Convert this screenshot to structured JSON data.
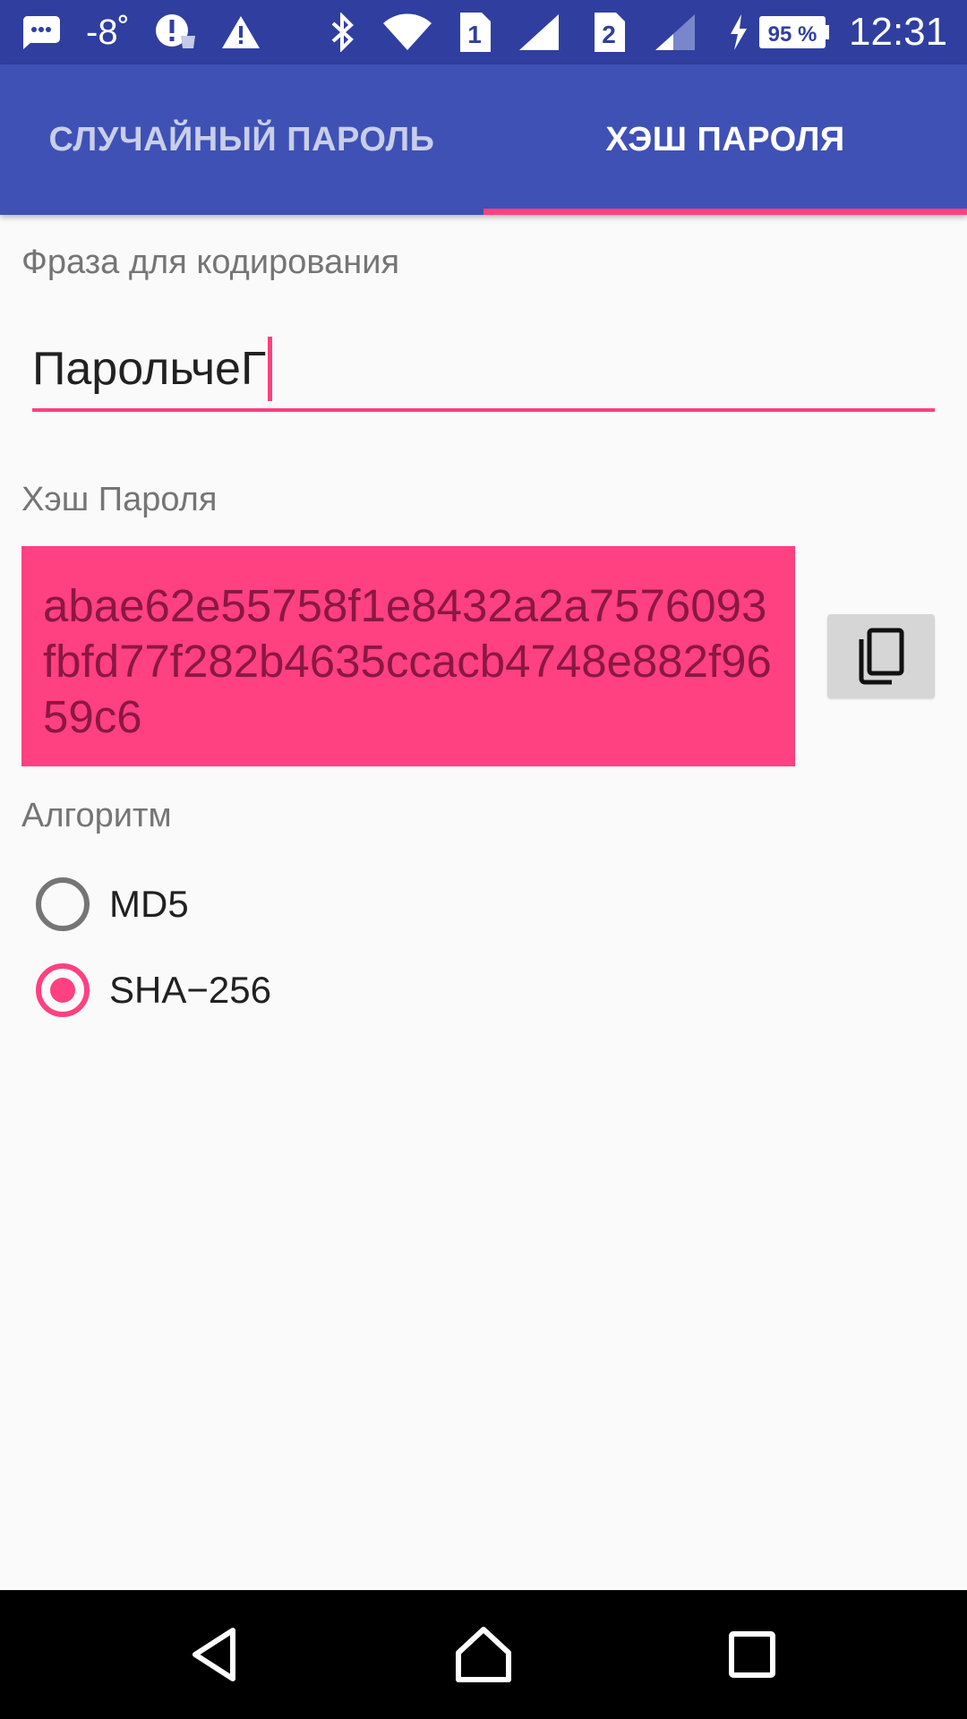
{
  "status_bar": {
    "temperature": "-8˚",
    "sim1": "1",
    "sim2": "2",
    "battery": "95 %",
    "time": "12:31",
    "icons": [
      "messages-icon",
      "alert-circle-icon",
      "warning-icon",
      "bluetooth-icon",
      "wifi-icon",
      "signal-icon",
      "charging-icon",
      "battery-icon"
    ]
  },
  "tabs": [
    {
      "label": "СЛУЧАЙНЫЙ ПАРОЛЬ",
      "selected": false
    },
    {
      "label": "ХЭШ ПАРОЛЯ",
      "selected": true
    }
  ],
  "form": {
    "phrase_label": "Фраза для кодирования",
    "phrase_value": "ПарольчеГ",
    "hash_label": "Хэш Пароля",
    "hash_value": "abae62e55758f1e8432a2a7576093fbfd77f282b4635ccacb4748e882f9659c6",
    "algorithm_label": "Алгоритм",
    "algorithms": [
      {
        "label": "MD5",
        "checked": false
      },
      {
        "label": "SHA−256",
        "checked": true
      }
    ]
  },
  "colors": {
    "primary": "#3f51b5",
    "primary_dark": "#303f9f",
    "accent": "#ff4081"
  },
  "nav_bar": {
    "icons": [
      "back-icon",
      "home-icon",
      "recents-icon"
    ]
  }
}
